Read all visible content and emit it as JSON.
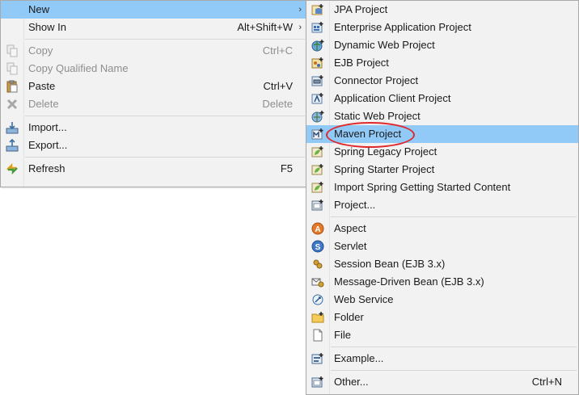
{
  "main_menu": {
    "items": [
      {
        "label": "New",
        "shortcut": "",
        "submenu": true,
        "icon": "none",
        "highlighted": true,
        "disabled": false
      },
      {
        "label": "Show In",
        "shortcut": "Alt+Shift+W",
        "submenu": true,
        "icon": "none",
        "highlighted": false,
        "disabled": false
      },
      {
        "label": "Copy",
        "shortcut": "Ctrl+C",
        "submenu": false,
        "icon": "copy-icon",
        "disabled": true
      },
      {
        "label": "Copy Qualified Name",
        "shortcut": "",
        "submenu": false,
        "icon": "copy-qualified-name-icon",
        "disabled": true
      },
      {
        "label": "Paste",
        "shortcut": "Ctrl+V",
        "submenu": false,
        "icon": "paste-icon",
        "disabled": false
      },
      {
        "label": "Delete",
        "shortcut": "Delete",
        "submenu": false,
        "icon": "delete-icon",
        "disabled": true
      },
      {
        "label": "Import...",
        "shortcut": "",
        "submenu": false,
        "icon": "import-icon",
        "disabled": false
      },
      {
        "label": "Export...",
        "shortcut": "",
        "submenu": false,
        "icon": "export-icon",
        "disabled": false
      },
      {
        "label": "Refresh",
        "shortcut": "F5",
        "submenu": false,
        "icon": "refresh-icon",
        "disabled": false
      }
    ]
  },
  "sub_menu": {
    "items": [
      {
        "label": "JPA Project",
        "icon": "jpa-project-icon"
      },
      {
        "label": "Enterprise Application Project",
        "icon": "enterprise-application-project-icon"
      },
      {
        "label": "Dynamic Web Project",
        "icon": "dynamic-web-project-icon"
      },
      {
        "label": "EJB Project",
        "icon": "ejb-project-icon"
      },
      {
        "label": "Connector Project",
        "icon": "connector-project-icon"
      },
      {
        "label": "Application Client Project",
        "icon": "application-client-project-icon"
      },
      {
        "label": "Static Web Project",
        "icon": "static-web-project-icon"
      },
      {
        "label": "Maven Project",
        "icon": "maven-project-icon",
        "highlighted": true
      },
      {
        "label": "Spring Legacy Project",
        "icon": "spring-legacy-project-icon"
      },
      {
        "label": "Spring Starter Project",
        "icon": "spring-starter-project-icon"
      },
      {
        "label": "Import Spring Getting Started Content",
        "icon": "import-spring-content-icon"
      },
      {
        "label": "Project...",
        "icon": "project-icon"
      },
      {
        "label": "Aspect",
        "icon": "aspect-icon"
      },
      {
        "label": "Servlet",
        "icon": "servlet-icon"
      },
      {
        "label": "Session Bean (EJB 3.x)",
        "icon": "session-bean-icon"
      },
      {
        "label": "Message-Driven Bean (EJB 3.x)",
        "icon": "message-driven-bean-icon"
      },
      {
        "label": "Web Service",
        "icon": "web-service-icon"
      },
      {
        "label": "Folder",
        "icon": "folder-icon"
      },
      {
        "label": "File",
        "icon": "file-icon"
      },
      {
        "label": "Example...",
        "icon": "example-icon"
      },
      {
        "label": "Other...",
        "icon": "other-icon",
        "shortcut": "Ctrl+N"
      }
    ]
  },
  "colors": {
    "highlight": "#91c9f7",
    "annotation_circle": "#e0282a",
    "menu_background": "#f2f2f2"
  }
}
